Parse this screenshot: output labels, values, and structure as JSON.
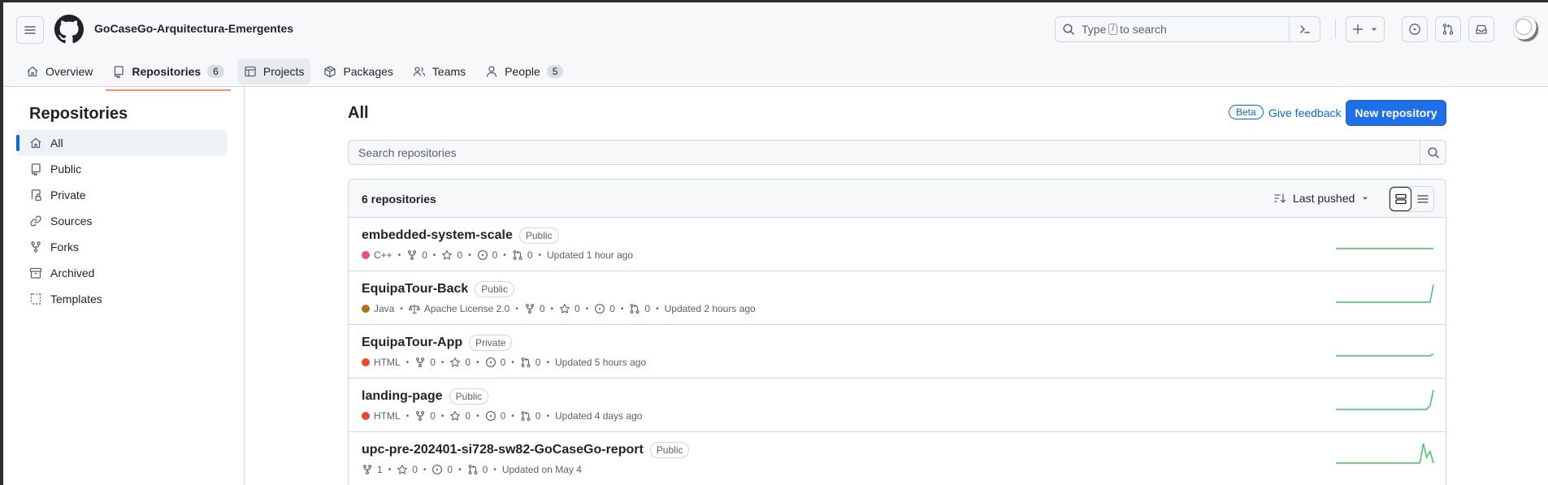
{
  "header": {
    "org_name": "GoCaseGo-Arquitectura-Emergentes",
    "search_prefix": "Type",
    "search_key": "/",
    "search_suffix": "to search"
  },
  "tabs": [
    {
      "label": "Overview",
      "icon": "home-icon"
    },
    {
      "label": "Repositories",
      "count": "6",
      "icon": "repo-icon"
    },
    {
      "label": "Projects",
      "icon": "table-icon"
    },
    {
      "label": "Packages",
      "icon": "package-icon"
    },
    {
      "label": "Teams",
      "icon": "people-icon"
    },
    {
      "label": "People",
      "count": "5",
      "icon": "person-icon"
    }
  ],
  "sidebar": {
    "title": "Repositories",
    "items": [
      {
        "label": "All",
        "icon": "home-icon"
      },
      {
        "label": "Public",
        "icon": "repo-icon"
      },
      {
        "label": "Private",
        "icon": "lock-icon"
      },
      {
        "label": "Sources",
        "icon": "link-icon"
      },
      {
        "label": "Forks",
        "icon": "fork-icon"
      },
      {
        "label": "Archived",
        "icon": "archive-icon"
      },
      {
        "label": "Templates",
        "icon": "template-icon"
      }
    ]
  },
  "main": {
    "title": "All",
    "beta": "Beta",
    "feedback": "Give feedback",
    "new_repo": "New repository",
    "search_placeholder": "Search repositories",
    "count_label": "6 repositories",
    "sort_label": "Last pushed"
  },
  "repos": [
    {
      "name": "embedded-system-scale",
      "visibility": "Public",
      "language": "C++",
      "lang_color": "#f34b7d",
      "forks": "0",
      "stars": "0",
      "issues": "0",
      "prs": "0",
      "updated": "Updated 1 hour ago",
      "activity": [
        0,
        0,
        0,
        0,
        0,
        0,
        0,
        0,
        0,
        0,
        0,
        0,
        0,
        0,
        0,
        0,
        0,
        0,
        0,
        0,
        0,
        0,
        0,
        0,
        0,
        0,
        0,
        0,
        0,
        0
      ]
    },
    {
      "name": "EquipaTour-Back",
      "visibility": "Public",
      "language": "Java",
      "lang_color": "#b07219",
      "license": "Apache License 2.0",
      "forks": "0",
      "stars": "0",
      "issues": "0",
      "prs": "0",
      "updated": "Updated 2 hours ago",
      "activity": [
        0,
        0,
        0,
        0,
        0,
        0,
        0,
        0,
        0,
        0,
        0,
        0,
        0,
        0,
        0,
        0,
        0,
        0,
        0,
        0,
        0,
        0,
        0,
        0,
        0,
        0,
        0,
        0,
        0,
        9
      ]
    },
    {
      "name": "EquipaTour-App",
      "visibility": "Private",
      "language": "HTML",
      "lang_color": "#e34c26",
      "forks": "0",
      "stars": "0",
      "issues": "0",
      "prs": "0",
      "updated": "Updated 5 hours ago",
      "activity": [
        0,
        0,
        0,
        0,
        0,
        0,
        0,
        0,
        0,
        0,
        0,
        0,
        0,
        0,
        0,
        0,
        0,
        0,
        0,
        0,
        0,
        0,
        0,
        0,
        0,
        0,
        0,
        0,
        0,
        1
      ]
    },
    {
      "name": "landing-page",
      "visibility": "Public",
      "language": "HTML",
      "lang_color": "#e34c26",
      "forks": "0",
      "stars": "0",
      "issues": "0",
      "prs": "0",
      "updated": "Updated 4 days ago",
      "activity": [
        0,
        0,
        0,
        0,
        0,
        0,
        0,
        0,
        0,
        0,
        0,
        0,
        0,
        0,
        0,
        0,
        0,
        0,
        0,
        0,
        0,
        0,
        0,
        0,
        0,
        0,
        0,
        0,
        2,
        10
      ]
    },
    {
      "name": "upc-pre-202401-si728-sw82-GoCaseGo-report",
      "visibility": "Public",
      "forks": "1",
      "stars": "0",
      "issues": "0",
      "prs": "0",
      "updated": "Updated on May 4",
      "activity": [
        0,
        0,
        0,
        0,
        0,
        0,
        0,
        0,
        0,
        0,
        0,
        0,
        0,
        0,
        0,
        0,
        0,
        0,
        0,
        0,
        0,
        0,
        0,
        0,
        0,
        0,
        10,
        3,
        6,
        0
      ]
    }
  ]
}
